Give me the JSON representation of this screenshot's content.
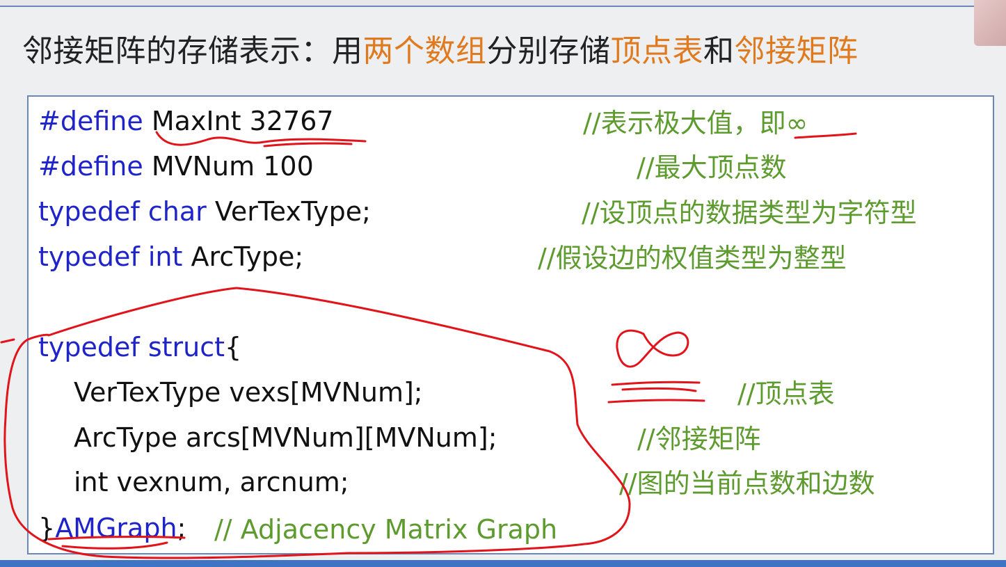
{
  "heading": {
    "part1": "邻接矩阵的存储表示：用",
    "part2": "两个数组",
    "part3": "分别存储",
    "part4": "顶点表",
    "part5": "和",
    "part6": "邻接矩阵"
  },
  "code": {
    "l1_kw": "#define",
    "l1_text": " MaxInt 32767",
    "l1_comment": "//表示极大值，即∞",
    "l2_kw": "#define",
    "l2_text": " MVNum 100",
    "l2_comment": "//最大顶点数",
    "l3_kw": "typedef char",
    "l3_text": " VerTexType;",
    "l3_comment": "//设顶点的数据类型为字符型",
    "l4_kw": "typedef int",
    "l4_text": " ArcType;",
    "l4_comment": "//假设边的权值类型为整型",
    "l5_kw": "typedef struct",
    "l5_text": "{",
    "l6_text": "VerTexType vexs[MVNum];",
    "l6_comment": "//顶点表",
    "l7_text": "ArcType arcs[MVNum][MVNum];",
    "l7_comment": "//邻接矩阵",
    "l8_text": "int vexnum, arcnum;",
    "l8_comment": "//图的当前点数和边数",
    "l9_brace": "}",
    "l9_name": "AMGraph",
    "l9_semi": ";",
    "l9_comment": "// Adjacency Matrix Graph"
  },
  "colors": {
    "keyword": "#1f24c9",
    "comment": "#5d9b2f",
    "highlight": "#e07a1f",
    "annotation": "#e0141a",
    "border": "#6b86b8"
  }
}
